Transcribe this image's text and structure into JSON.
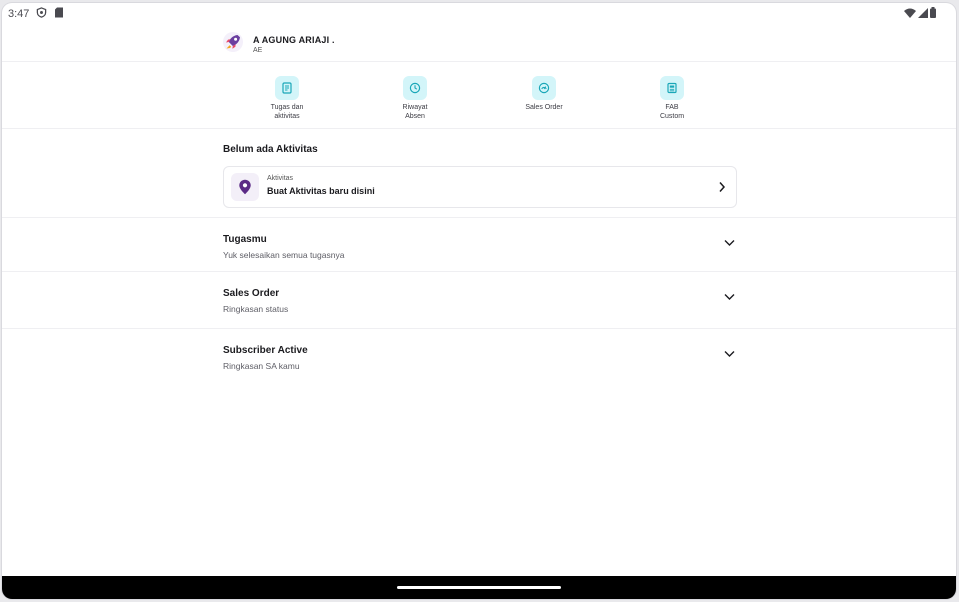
{
  "status_bar": {
    "time": "3:47",
    "icons": [
      "shield-icon",
      "sd-card-icon",
      "wifi-icon",
      "signal-icon",
      "battery-icon"
    ]
  },
  "header": {
    "user_name": "A AGUNG ARIAJI .",
    "user_role": "AE",
    "avatar_icon": "rocket-avatar-icon"
  },
  "quick_menu": [
    {
      "label": "Tugas dan\naktivitas",
      "icon": "task-list-icon"
    },
    {
      "label": "Riwayat\nAbsen",
      "icon": "clock-icon"
    },
    {
      "label": "Sales Order",
      "icon": "gauge-icon"
    },
    {
      "label": "FAB\nCustom",
      "icon": "document-icon"
    }
  ],
  "activity": {
    "section_title": "Belum ada Aktivitas",
    "card_label": "Aktivitas",
    "card_action": "Buat Aktivitas baru disini"
  },
  "sections": [
    {
      "title": "Tugasmu",
      "subtitle": "Yuk selesaikan semua tugasnya"
    },
    {
      "title": "Sales Order",
      "subtitle": "Ringkasan status"
    },
    {
      "title": "Subscriber Active",
      "subtitle": "Ringkasan SA kamu"
    }
  ],
  "colors": {
    "accent_tile": "#d3f5f9",
    "accent_icon": "#1aa7b8",
    "activity_icon": "#5b2a86"
  }
}
